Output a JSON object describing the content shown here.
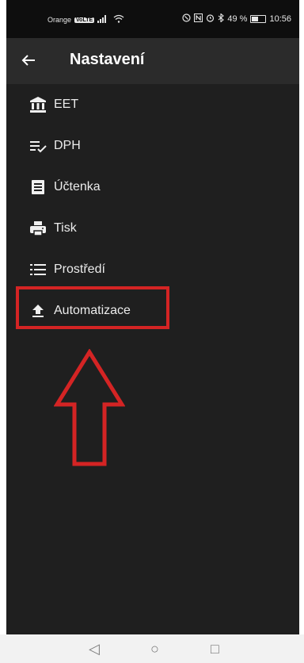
{
  "status_bar": {
    "carrier": "Orange",
    "volte": "VoLTE",
    "battery_percent": "49 %",
    "time": "10:56",
    "battery_level": 0.49
  },
  "app_bar": {
    "back_icon": "arrow-left-icon",
    "title": "Nastavení"
  },
  "menu": {
    "items": [
      {
        "label": "EET",
        "icon": "bank-icon"
      },
      {
        "label": "DPH",
        "icon": "list-check-icon"
      },
      {
        "label": "Účtenka",
        "icon": "receipt-icon"
      },
      {
        "label": "Tisk",
        "icon": "printer-icon"
      },
      {
        "label": "Prostředí",
        "icon": "list-icon"
      },
      {
        "label": "Automatizace",
        "icon": "upload-icon"
      }
    ]
  },
  "annotation": {
    "highlight_color": "#d42424"
  },
  "nav_bar": {
    "back": "◁",
    "home": "○",
    "recents": "□"
  }
}
